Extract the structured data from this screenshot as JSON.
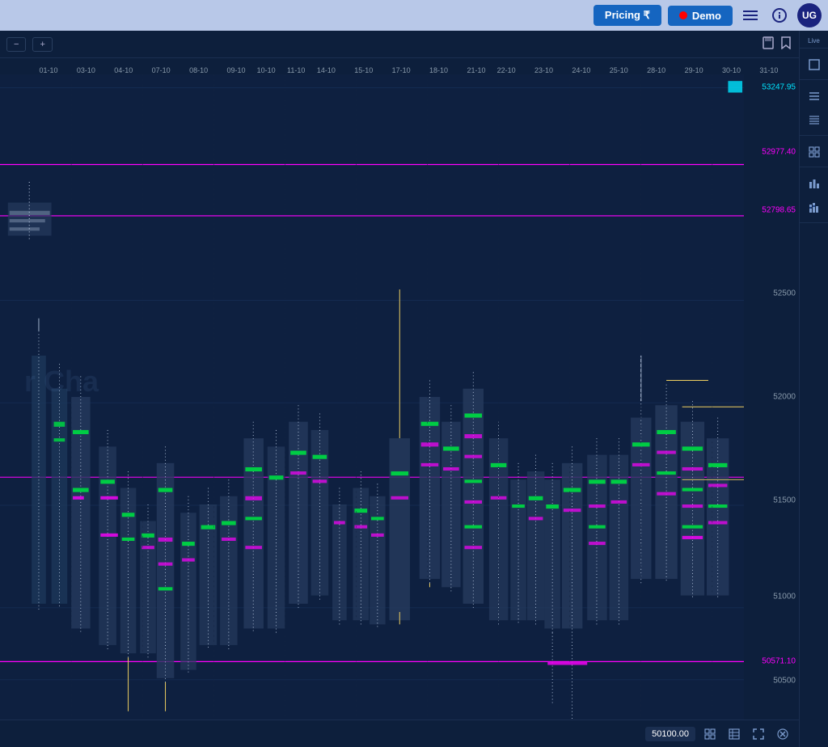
{
  "topbar": {
    "pricing_label": "Pricing ₹",
    "demo_label": "Demo",
    "avatar_text": "UG",
    "live_label": "Live"
  },
  "toolbar": {
    "minus_label": "−",
    "plus_label": "+"
  },
  "time_labels": [
    "01-10",
    "03-10",
    "04-10",
    "07-10",
    "08-10",
    "09-10",
    "10-10",
    "11-10",
    "14-10",
    "15-10",
    "17-10",
    "18-10",
    "21-10",
    "22-10",
    "23-10",
    "24-10",
    "25-10",
    "28-10",
    "29-10",
    "30-10",
    "31-10"
  ],
  "price_levels": [
    {
      "value": "53247.95",
      "pct": 2,
      "highlight": true,
      "color": "#00e5ff"
    },
    {
      "value": "52977.40",
      "pct": 14,
      "highlight": false,
      "color": "#ff00ff"
    },
    {
      "value": "52798.65",
      "pct": 22,
      "highlight": false,
      "color": "#ff00ff"
    },
    {
      "value": "52500",
      "pct": 35,
      "highlight": false,
      "color": "#8899aa"
    },
    {
      "value": "52000",
      "pct": 51,
      "highlight": false,
      "color": "#8899aa"
    },
    {
      "value": "51500",
      "pct": 67,
      "highlight": false,
      "color": "#8899aa"
    },
    {
      "value": "51000",
      "pct": 82,
      "highlight": false,
      "color": "#8899aa"
    },
    {
      "value": "50571.10",
      "pct": 91,
      "highlight": false,
      "color": "#ff00ff"
    },
    {
      "value": "50500",
      "pct": 94,
      "highlight": false,
      "color": "#8899aa"
    }
  ],
  "bottom": {
    "price_box": "50100.00"
  },
  "watermark": "r Cha"
}
